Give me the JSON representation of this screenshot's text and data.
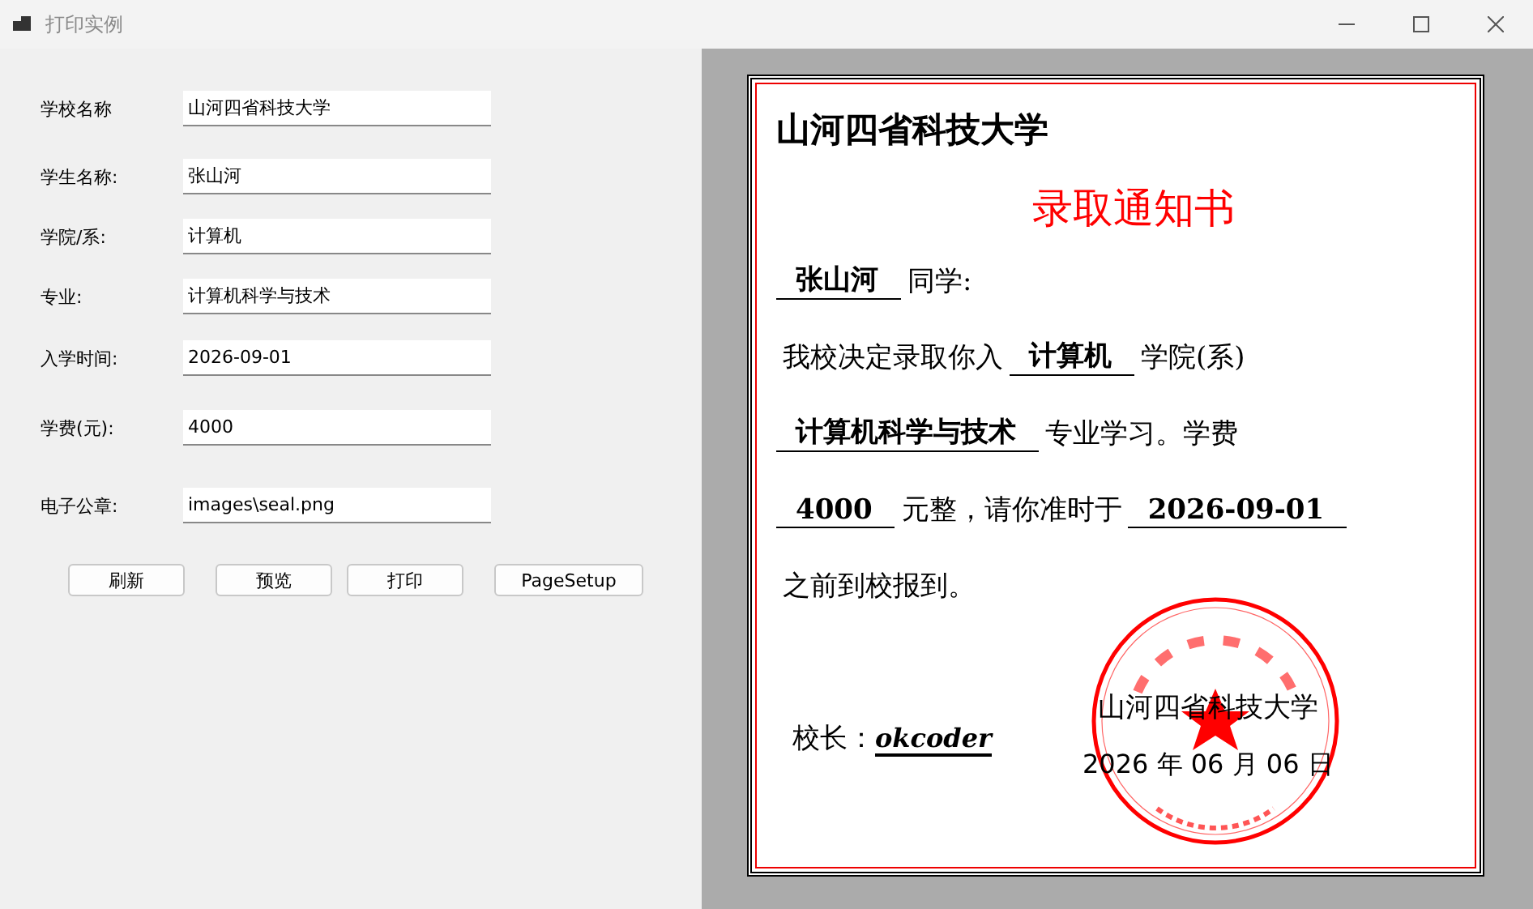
{
  "window": {
    "title": "打印实例"
  },
  "form": {
    "fields": [
      {
        "label": "学校名称",
        "value": "山河四省科技大学"
      },
      {
        "label": "学生名称:",
        "value": "张山河"
      },
      {
        "label": "学院/系:",
        "value": "计算机"
      },
      {
        "label": "专业:",
        "value": "计算机科学与技术"
      },
      {
        "label": "入学时间:",
        "value": "2026-09-01"
      },
      {
        "label": "学费(元):",
        "value": "4000"
      },
      {
        "label": "电子公章:",
        "value": "images\\seal.png"
      }
    ],
    "buttons": [
      "刷新",
      "预览",
      "打印",
      "PageSetup"
    ]
  },
  "preview": {
    "school": "山河四省科技大学",
    "heading": "录取通知书",
    "lines": [
      [
        {
          "kind": "fill",
          "text": "张山河"
        },
        {
          "kind": "text",
          "text": "同学:"
        }
      ],
      [
        {
          "kind": "text",
          "text": "我校决定录取你入"
        },
        {
          "kind": "fill",
          "text": "计算机"
        },
        {
          "kind": "text",
          "text": "学院(系)"
        }
      ],
      [
        {
          "kind": "fill",
          "text": "计算机科学与技术"
        },
        {
          "kind": "text",
          "text": "专业学习。学费"
        }
      ],
      [
        {
          "kind": "fill",
          "text": "4000"
        },
        {
          "kind": "text",
          "text": "元整，请你准时于"
        },
        {
          "kind": "fill",
          "text": "2026-09-01"
        }
      ],
      [
        {
          "kind": "text",
          "text": "之前到校报到。"
        }
      ]
    ],
    "principal_label": "校长：",
    "principal_name": "okcoder",
    "stamp_school": "山河四省科技大学",
    "date": "2026 年 06 月 06 日",
    "seal": {
      "kind": "picture"
    }
  }
}
